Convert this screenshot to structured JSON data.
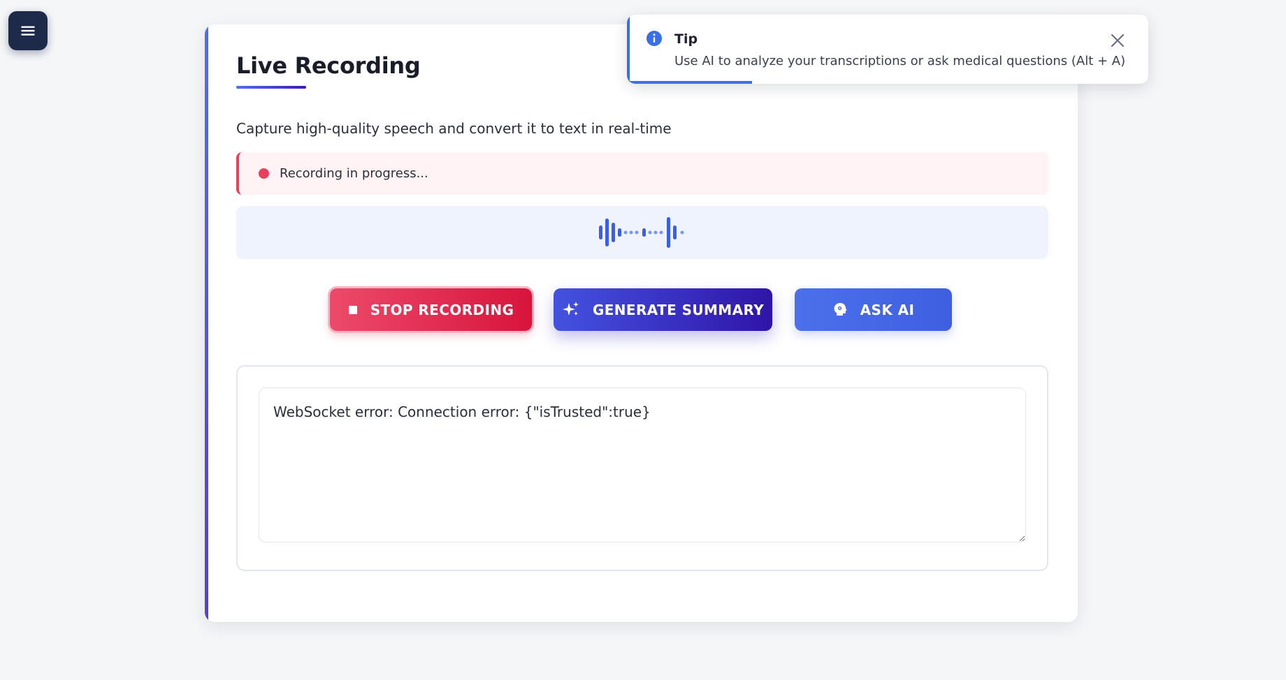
{
  "menu": {
    "icon": "hamburger-menu-icon"
  },
  "recording_card": {
    "title": "Live Recording",
    "subtitle": "Capture high-quality speech and convert it to text in real-time",
    "status": {
      "text": "Recording in progress...",
      "color": "#e8405f"
    },
    "waveform": {
      "icon": "audio-waveform-icon",
      "color": "#3b5ee8"
    },
    "buttons": {
      "stop": {
        "label": "STOP RECORDING",
        "icon": "stop-square-icon",
        "color": "#e11d48"
      },
      "summary": {
        "label": "GENERATE SUMMARY",
        "icon": "sparkles-icon",
        "color": "#3b2bc0"
      },
      "ask_ai": {
        "label": "ASK AI",
        "icon": "brain-bulb-icon",
        "color": "#4569ea"
      }
    },
    "transcript": {
      "value": "WebSocket error: Connection error: {\"isTrusted\":true}"
    }
  },
  "toast": {
    "title": "Tip",
    "message": "Use AI to analyze your transcriptions or ask medical questions (Alt + A)",
    "icon": "info-circle-icon",
    "close_icon": "close-x-icon",
    "progress_fraction": 0.24,
    "accent_color": "#3b6fe8"
  }
}
